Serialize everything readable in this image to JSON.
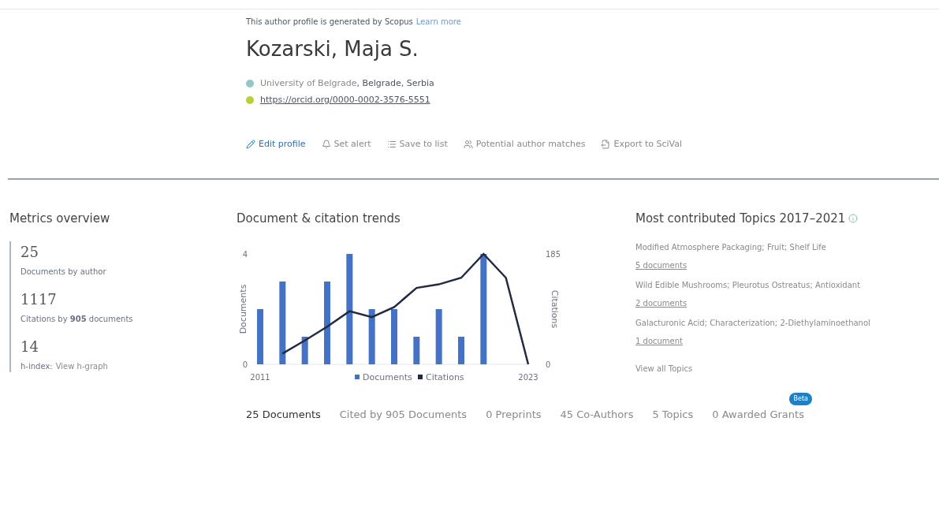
{
  "header": {
    "notice": "This author profile is generated by Scopus",
    "notice_link": "Learn more",
    "name": "Kozarski, Maja S.",
    "affiliation_link": "University of Belgrade",
    "affiliation_rest": ", Belgrade, Serbia",
    "orcid": "https://orcid.org/0000-0002-3576-5551"
  },
  "actions": [
    {
      "label": "Edit profile",
      "disabled": false
    },
    {
      "label": "Set alert",
      "disabled": true
    },
    {
      "label": "Save to list",
      "disabled": true
    },
    {
      "label": "Potential author matches",
      "disabled": true
    },
    {
      "label": "Export to SciVal",
      "disabled": true
    }
  ],
  "metrics": {
    "title": "Metrics overview",
    "items": [
      {
        "value": "25",
        "label": "Documents by author"
      },
      {
        "value": "1117",
        "label": "Citations by **905** documents"
      },
      {
        "value": "14",
        "label": "h-index:",
        "link": "View h-graph"
      }
    ]
  },
  "trends": {
    "title": "Document & citation trends",
    "documents": {
      "chart_data": {
        "type": "bar",
        "ylabel": "Documents",
        "x": [
          2011,
          2012,
          2013,
          2014,
          2015,
          2016,
          2017,
          2018,
          2019,
          2020,
          2021
        ],
        "xlim": [
          2011,
          2023
        ],
        "xticks": [
          2011,
          2023
        ],
        "ylim": [
          0,
          4
        ],
        "yticks": [
          0,
          4
        ],
        "series": [
          {
            "name": "Documents",
            "color": "#4472c4",
            "values": [
              2,
              3,
              1,
              3,
              4,
              2,
              2,
              1,
              2,
              1,
              4
            ]
          }
        ]
      }
    },
    "citations": {
      "chart_data": {
        "type": "line",
        "ylabel": "Citations",
        "x": [
          2012,
          2013,
          2014,
          2015,
          2016,
          2017,
          2018,
          2019,
          2020,
          2021,
          2022,
          2023
        ],
        "xlim": [
          2011,
          2023
        ],
        "ylim": [
          0,
          185
        ],
        "yticks": [
          0,
          185
        ],
        "series": [
          {
            "name": "Citations",
            "color": "#1f2a44",
            "values": [
              18,
              40,
              63,
              89,
              79,
              96,
              128,
              134,
              145,
              185,
              145,
              0
            ]
          }
        ]
      }
    }
  },
  "topics": {
    "title": "Most contributed Topics 2017–2021",
    "items": [
      {
        "name": "Modified Atmosphere Packaging; Fruit; Shelf Life",
        "count": "5 documents"
      },
      {
        "name": "Wild Edible Mushrooms; Pleurotus Ostreatus; Antioxidant",
        "count": "2 documents"
      },
      {
        "name": "Galacturonic Acid; Characterization; 2-Diethylaminoethanol",
        "count": "1 document"
      }
    ],
    "view_all": "View all Topics"
  },
  "tabs": [
    {
      "label": "25 Documents",
      "selected": true
    },
    {
      "label": "Cited by 905 Documents",
      "selected": false
    },
    {
      "label": "0 Preprints",
      "selected": false
    },
    {
      "label": "45 Co-Authors",
      "selected": false
    },
    {
      "label": "5 Topics",
      "selected": false
    },
    {
      "label": "0 Awarded Grants",
      "selected": false,
      "badge": "Beta"
    }
  ]
}
